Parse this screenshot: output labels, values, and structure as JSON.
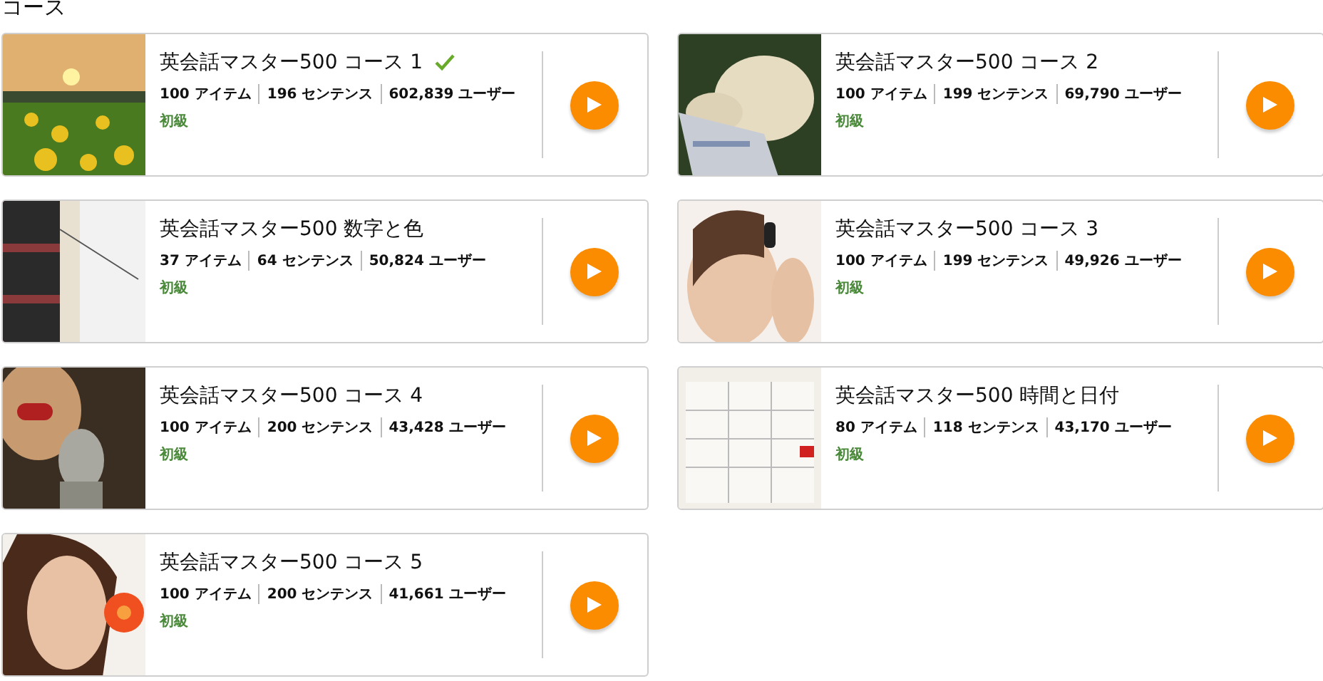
{
  "heading": "コース",
  "courses": [
    {
      "title": "英会話マスター500 コース 1",
      "completed": true,
      "items": "100 アイテム",
      "sentences": "196 センテンス",
      "users": "602,839 ユーザー",
      "level_label": "初級"
    },
    {
      "title": "英会話マスター500 コース 2",
      "completed": false,
      "items": "100 アイテム",
      "sentences": "199 センテンス",
      "users": "69,790 ユーザー",
      "level_label": "初級"
    },
    {
      "title": "英会話マスター500 数字と色",
      "completed": false,
      "items": "37 アイテム",
      "sentences": "64 センテンス",
      "users": "50,824 ユーザー",
      "level_label": "初級"
    },
    {
      "title": "英会話マスター500 コース 3",
      "completed": false,
      "items": "100 アイテム",
      "sentences": "199 センテンス",
      "users": "49,926 ユーザー",
      "level_label": "初級"
    },
    {
      "title": "英会話マスター500 コース 4",
      "completed": false,
      "items": "100 アイテム",
      "sentences": "200 センテンス",
      "users": "43,428 ユーザー",
      "level_label": "初級"
    },
    {
      "title": "英会話マスター500 時間と日付",
      "completed": false,
      "items": "80 アイテム",
      "sentences": "118 センテンス",
      "users": "43,170 ユーザー",
      "level_label": "初級"
    },
    {
      "title": "英会話マスター500 コース 5",
      "completed": false,
      "items": "100 アイテム",
      "sentences": "200 センテンス",
      "users": "41,661 ユーザー",
      "level_label": "初級"
    }
  ]
}
